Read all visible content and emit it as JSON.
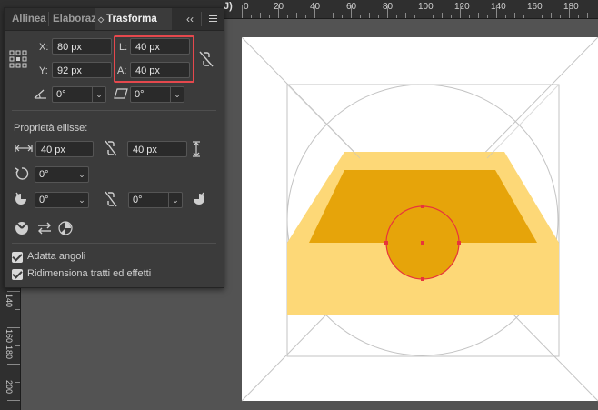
{
  "ruler": {
    "top_fragment": "J)",
    "top_labels": [
      "0",
      "20",
      "40",
      "60",
      "80",
      "100",
      "120",
      "140",
      "160",
      "180"
    ],
    "left_labels": [
      "140",
      "160",
      "180",
      "200"
    ]
  },
  "panel": {
    "tabs": [
      {
        "label": "Allinea",
        "active": false
      },
      {
        "label": "Elaborazi",
        "active": false
      },
      {
        "label": "Trasforma",
        "active": true
      }
    ],
    "collapse_label": "‹‹",
    "transform": {
      "x_label": "X:",
      "x_value": "80 px",
      "y_label": "Y:",
      "y_value": "92 px",
      "w_label": "L:",
      "w_value": "40 px",
      "h_label": "A:",
      "h_value": "40 px",
      "rotate_value": "0°",
      "shear_value": "0°"
    },
    "ellipse": {
      "title": "Proprietà ellisse:",
      "width_value": "40 px",
      "height_value": "40 px",
      "rotation_value": "0°",
      "pie_start_value": "0°",
      "pie_end_value": "0°"
    },
    "options": {
      "scale_corners": "Adatta angoli",
      "scale_strokes": "Ridimensiona tratti ed effetti"
    }
  },
  "colors": {
    "shape_light": "#fdd877",
    "shape_dark": "#e6a40a",
    "selection": "#e8343c",
    "guide": "#bdbdbd"
  }
}
